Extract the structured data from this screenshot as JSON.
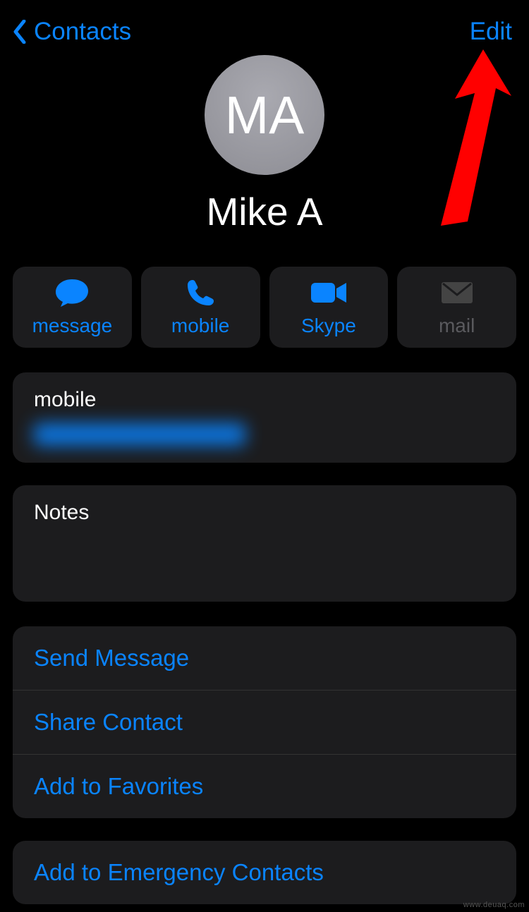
{
  "nav": {
    "back_label": "Contacts",
    "edit_label": "Edit"
  },
  "contact": {
    "initials": "MA",
    "name": "Mike A"
  },
  "actions": {
    "message": "message",
    "mobile": "mobile",
    "skype": "Skype",
    "mail": "mail"
  },
  "mobile_section": {
    "label": "mobile"
  },
  "notes_section": {
    "label": "Notes"
  },
  "links": {
    "send_message": "Send Message",
    "share_contact": "Share Contact",
    "add_favorites": "Add to Favorites",
    "add_emergency": "Add to Emergency Contacts"
  },
  "watermark": "www.deuaq.com",
  "colors": {
    "accent": "#0a84ff",
    "card": "#1c1c1e"
  }
}
